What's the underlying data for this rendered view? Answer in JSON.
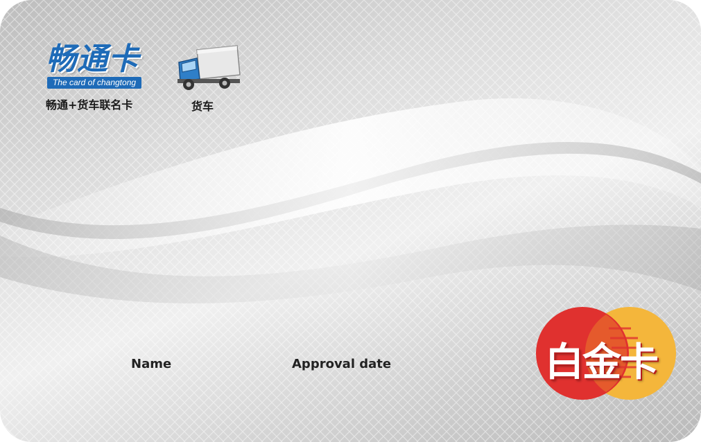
{
  "card": {
    "brand_cn": "畅通卡",
    "brand_en": "The card of changtong",
    "subtitle": "畅通+货车联名卡",
    "truck_label": "货车",
    "name_label": "Name",
    "approval_label": "Approval date",
    "tier_badge": "白金卡"
  },
  "icons": {
    "truck": "truck-icon",
    "badge": "mastercard-style-circles"
  },
  "colors": {
    "brand_blue": "#1e6bb8",
    "badge_red": "#e0312f",
    "badge_yellow": "#f4b63b",
    "card_silver": "#d8d8d8"
  }
}
